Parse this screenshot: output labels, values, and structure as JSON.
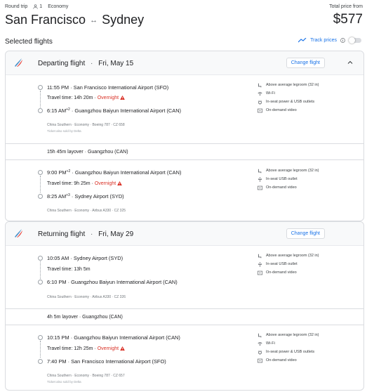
{
  "header": {
    "trip_type": "Round trip",
    "passengers": "1",
    "cabin": "Economy",
    "origin": "San Francisco",
    "route_arrow": "↔",
    "destination": "Sydney",
    "total_label": "Total price from",
    "total_price": "$577"
  },
  "section_title": "Selected flights",
  "track_prices": {
    "label": "Track prices",
    "enabled": false
  },
  "cards": [
    {
      "title": "Departing flight",
      "date": "Fri, May 15",
      "change_label": "Change flight",
      "legs": [
        {
          "dep_time": "11:55 PM",
          "dep_airport": "San Francisco International Airport (SFO)",
          "travel_time": "Travel time: 14h 20m",
          "overnight": "Overnight",
          "arr_time": "6:15 AM",
          "arr_plus": "+2",
          "arr_airport": "Guangzhou Baiyun International Airport (CAN)",
          "details": "China Southern · Economy · Boeing 787 · CZ 658",
          "sold_by": "Ticket also sold by Delta",
          "amenities": [
            "Above average legroom (32 in)",
            "Wi-Fi",
            "In-seat power & USB outlets",
            "On-demand video"
          ]
        },
        {
          "dep_time": "9:00 PM",
          "dep_plus": "+2",
          "dep_airport": "Guangzhou Baiyun International Airport (CAN)",
          "travel_time": "Travel time: 9h 25m",
          "overnight": "Overnight",
          "arr_time": "8:25 AM",
          "arr_plus": "+3",
          "arr_airport": "Sydney Airport (SYD)",
          "details": "China Southern · Economy · Airbus A330 · CZ 325",
          "amenities": [
            "Above average legroom (32 in)",
            "In-seat USB outlet",
            "On-demand video"
          ]
        }
      ],
      "layover": "15h 45m layover · Guangzhou (CAN)"
    },
    {
      "title": "Returning flight",
      "date": "Fri, May 29",
      "change_label": "Change flight",
      "legs": [
        {
          "dep_time": "10:05 AM",
          "dep_airport": "Sydney Airport (SYD)",
          "travel_time": "Travel time: 13h 5m",
          "arr_time": "6:10 PM",
          "arr_airport": "Guangzhou Baiyun International Airport (CAN)",
          "details": "China Southern · Economy · Airbus A330 · CZ 326",
          "amenities": [
            "Above average legroom (32 in)",
            "In-seat USB outlet",
            "On-demand video"
          ]
        },
        {
          "dep_time": "10:15 PM",
          "dep_airport": "Guangzhou Baiyun International Airport (CAN)",
          "travel_time": "Travel time: 12h 25m",
          "overnight": "Overnight",
          "arr_time": "7:40 PM",
          "arr_airport": "San Francisco International Airport (SFO)",
          "details": "China Southern · Economy · Boeing 787 · CZ 657",
          "sold_by": "Ticket also sold by Delta",
          "amenities": [
            "Above average legroom (32 in)",
            "Wi-Fi",
            "In-seat power & USB outlets",
            "On-demand video"
          ]
        }
      ],
      "layover": "4h 5m layover · Guangzhou (CAN)"
    }
  ],
  "colors": {
    "accent": "#1a73e8",
    "warning": "#d93025",
    "border": "#dadce0"
  }
}
